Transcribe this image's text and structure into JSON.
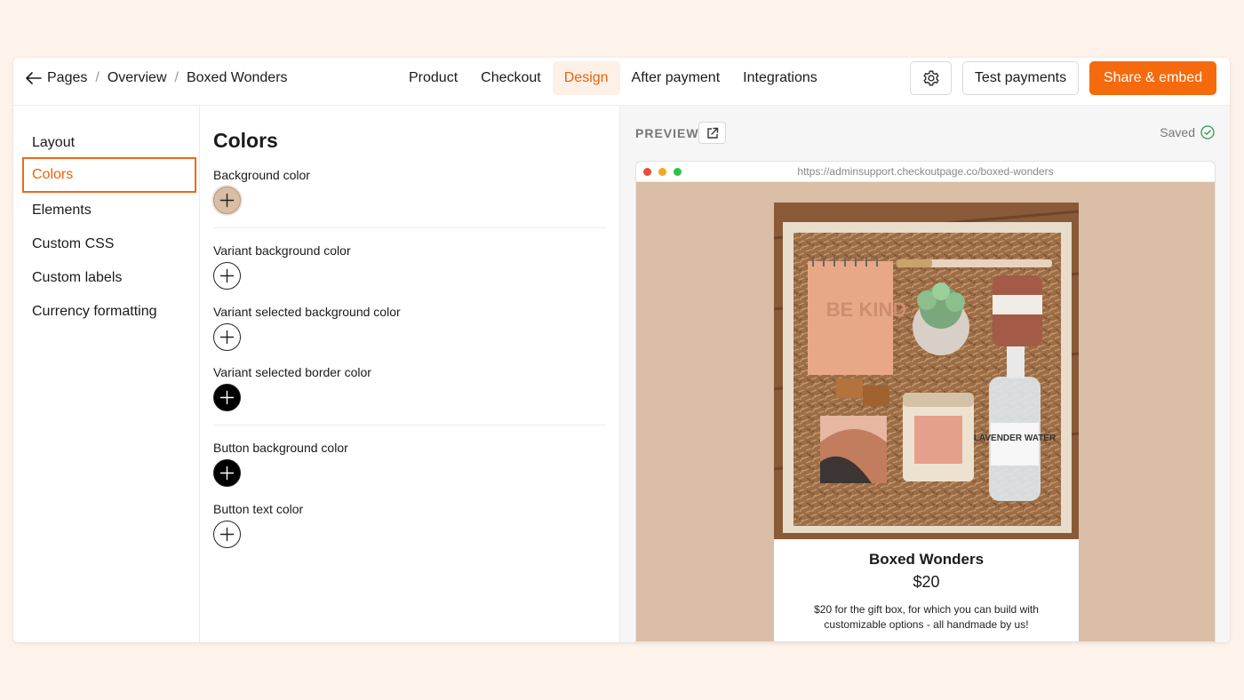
{
  "breadcrumb": {
    "items": [
      "Pages",
      "Overview",
      "Boxed Wonders"
    ]
  },
  "nav": {
    "tabs": [
      {
        "label": "Product"
      },
      {
        "label": "Checkout"
      },
      {
        "label": "Design",
        "active": true
      },
      {
        "label": "After payment"
      },
      {
        "label": "Integrations"
      }
    ]
  },
  "toolbar": {
    "settings_icon": "gear-icon",
    "test_label": "Test payments",
    "share_label": "Share & embed"
  },
  "sidebar": {
    "items": [
      {
        "label": "Layout"
      },
      {
        "label": "Colors",
        "active": true
      },
      {
        "label": "Elements"
      },
      {
        "label": "Custom CSS"
      },
      {
        "label": "Custom labels"
      },
      {
        "label": "Currency formatting"
      }
    ]
  },
  "colors_panel": {
    "title": "Colors",
    "fields": [
      {
        "label": "Background color",
        "color": "#d9bda5"
      },
      {
        "label": "Variant background color",
        "color": "#ffffff"
      },
      {
        "label": "Variant selected background color",
        "color": "#ffffff"
      },
      {
        "label": "Variant selected border color",
        "color": "#000000"
      },
      {
        "label": "Button background color",
        "color": "#000000"
      },
      {
        "label": "Button text color",
        "color": "#ffffff"
      }
    ]
  },
  "preview": {
    "label": "PREVIEW",
    "saved_label": "Saved",
    "url": "https://adminsupport.checkoutpage.co/boxed-wonders",
    "product": {
      "name": "Boxed Wonders",
      "price": "$20",
      "description": "$20 for the gift box, for which you can build with customizable options - all handmade by us!"
    },
    "image_text": {
      "notebook": "BE KIND",
      "spray": "LAVENDER WATER"
    }
  },
  "colors": {
    "accent": "#f56a0c",
    "preview_bg": "#d9bda5"
  }
}
